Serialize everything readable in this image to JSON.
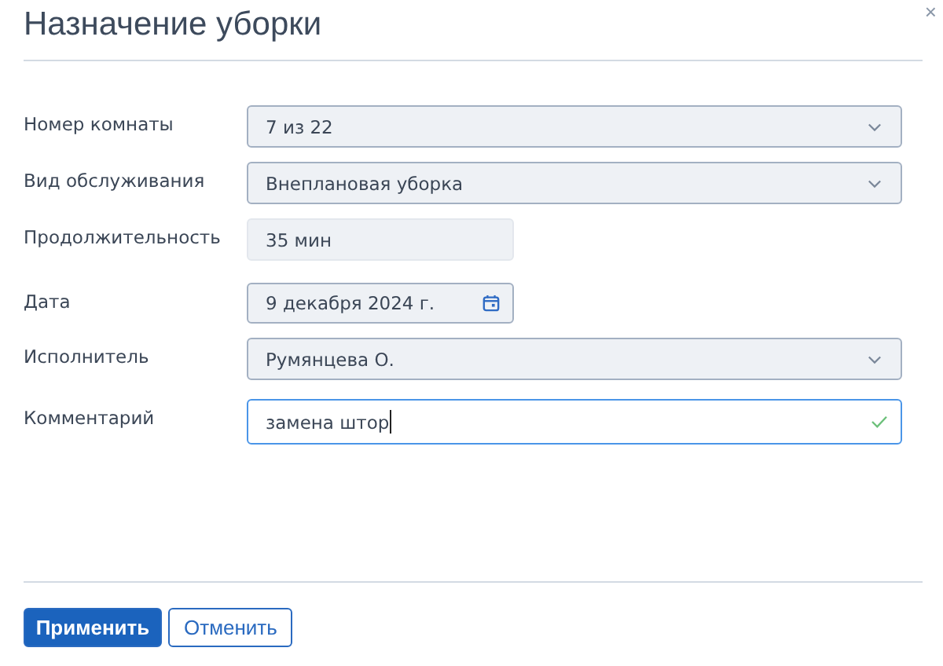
{
  "dialog": {
    "title": "Назначение уборки",
    "close": "×"
  },
  "fields": [
    {
      "label": "Номер комнаты",
      "kind": "select",
      "value": "7 из 22"
    },
    {
      "label": "Вид обслуживания",
      "kind": "select",
      "value": "Внеплановая уборка"
    },
    {
      "label": "Продолжительность",
      "kind": "readonly",
      "value": "35 мин"
    },
    {
      "label": "Дата",
      "kind": "date",
      "value": "9 декабря 2024 г."
    },
    {
      "label": "Исполнитель",
      "kind": "select",
      "value": "Румянцева О."
    },
    {
      "label": "Комментарий",
      "kind": "text",
      "value": "замена штор",
      "focused": true,
      "valid": true
    }
  ],
  "buttons": [
    {
      "label": "Применить",
      "primary": true
    },
    {
      "label": "Отменить",
      "primary": false
    }
  ]
}
